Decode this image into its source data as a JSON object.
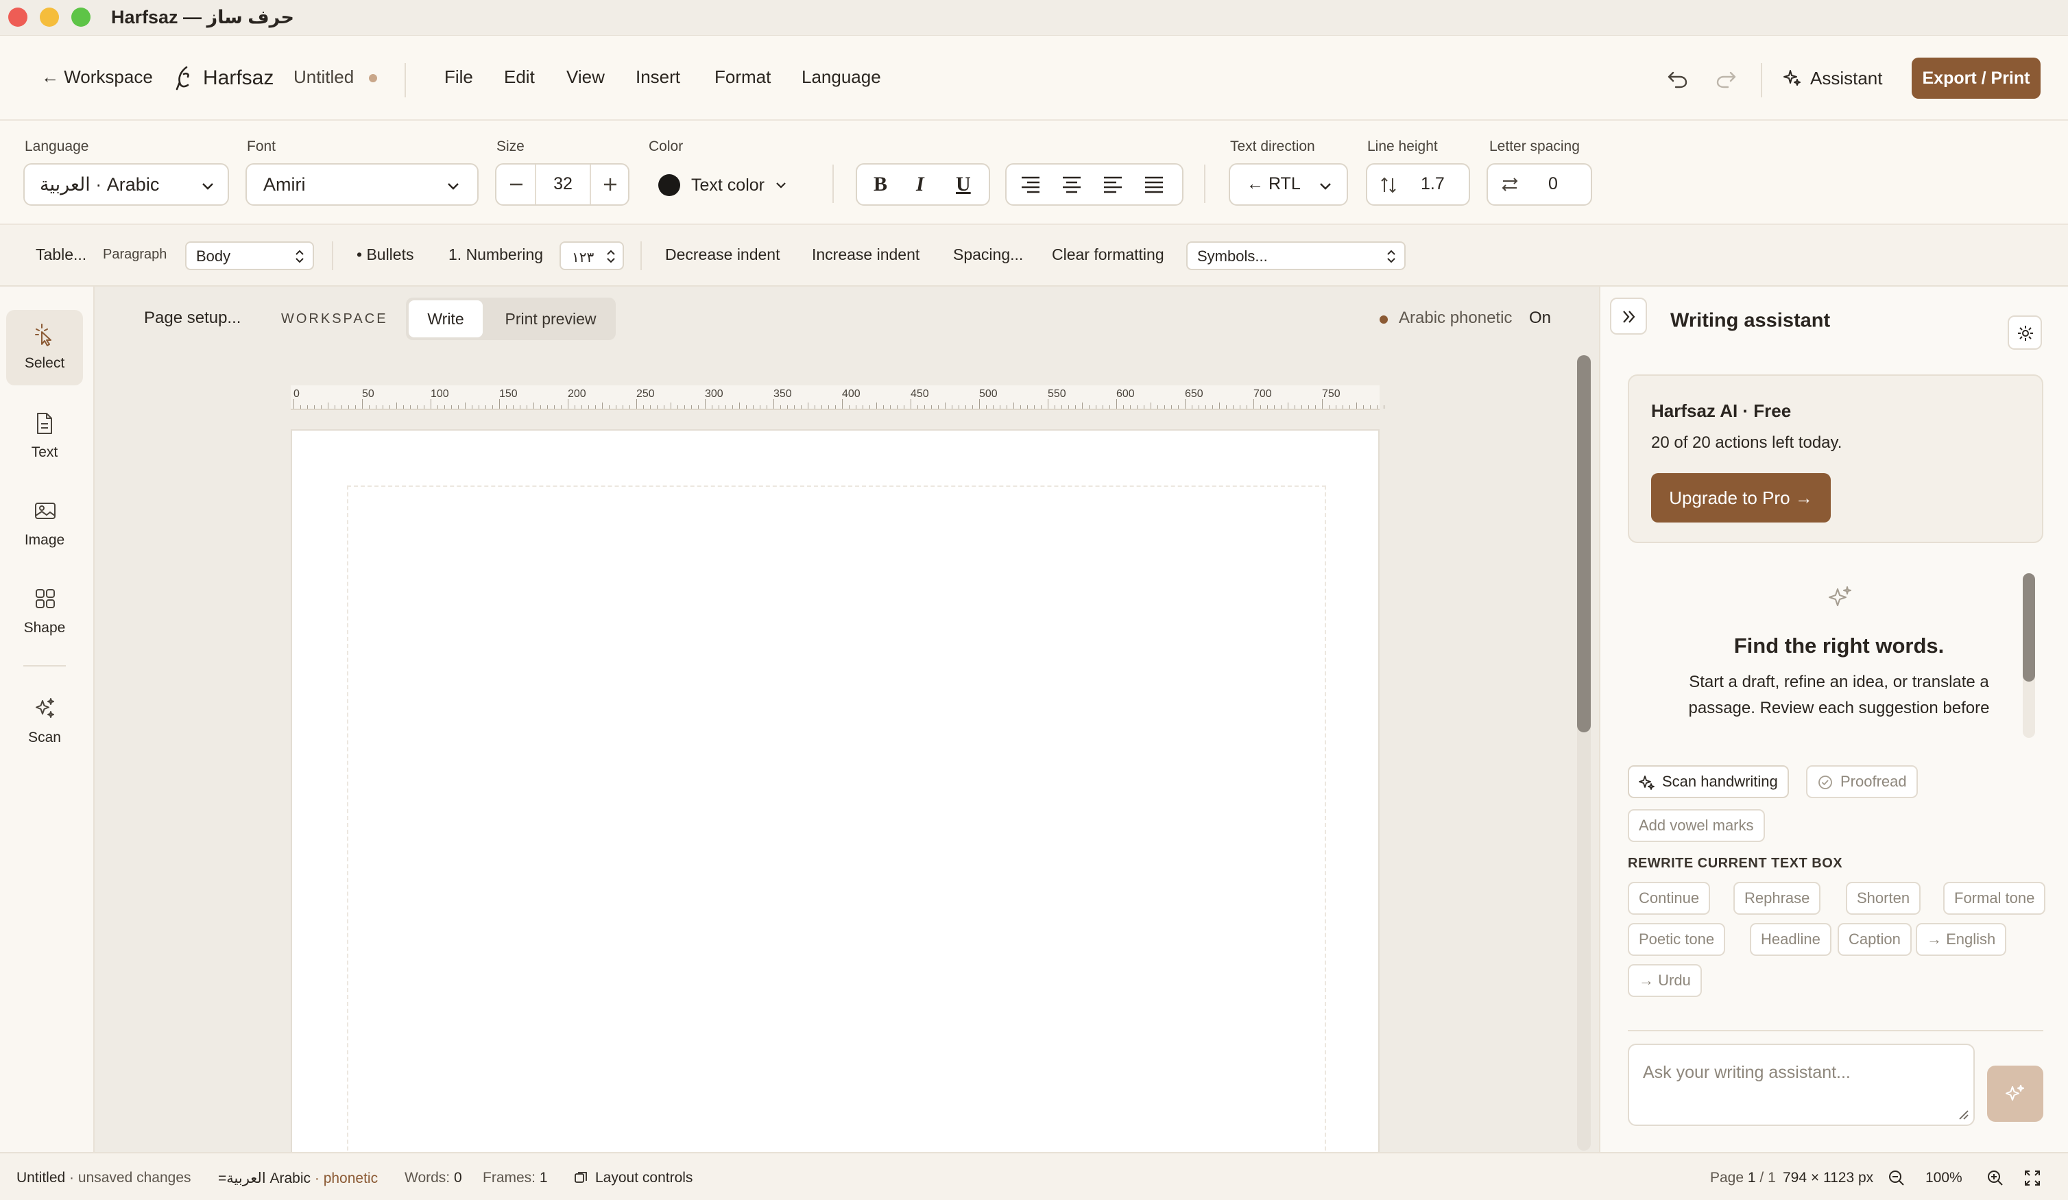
{
  "window": {
    "title": "Harfsaz — حرف ساز"
  },
  "menubar": {
    "back_label": "← Workspace",
    "brand": "Harfsaz",
    "doc_title": "Untitled",
    "menus": [
      "File",
      "Edit",
      "View",
      "Insert",
      "Format",
      "Language"
    ],
    "assistant_label": "Assistant",
    "export_label": "Export / Print"
  },
  "format_toolbar": {
    "language_label": "Language",
    "language_value": "العربية · Arabic",
    "font_label": "Font",
    "font_value": "Amiri",
    "size_label": "Size",
    "size_value": "32",
    "color_label": "Color",
    "color_value": "Text color",
    "bold": "B",
    "italic": "I",
    "underline": "U",
    "direction_label": "Text direction",
    "direction_value": "← RTL",
    "line_height_label": "Line height",
    "line_height_value": "1.7",
    "letter_spacing_label": "Letter spacing",
    "letter_spacing_value": "0"
  },
  "paragraph_bar": {
    "table": "Table...",
    "paragraph_label": "Paragraph",
    "paragraph_value": "Body",
    "bullets": "• Bullets",
    "numbering": "1. Numbering",
    "numbering_style": "١٢٣",
    "decrease_indent": "Decrease indent",
    "increase_indent": "Increase indent",
    "spacing": "Spacing...",
    "clear_formatting": "Clear formatting",
    "symbols": "Symbols..."
  },
  "tools": [
    {
      "label": "Select",
      "icon": "cursor-click-icon"
    },
    {
      "label": "Text",
      "icon": "document-icon"
    },
    {
      "label": "Image",
      "icon": "image-icon"
    },
    {
      "label": "Shape",
      "icon": "shape-grid-icon"
    },
    {
      "label": "Scan",
      "icon": "sparkles-icon"
    }
  ],
  "canvas_header": {
    "page_setup": "Page setup...",
    "workspace_label": "WORKSPACE",
    "modes": [
      "Write",
      "Print preview"
    ],
    "active_mode": "Write",
    "phonetic_label": "Arabic phonetic",
    "phonetic_state": "On"
  },
  "ruler": {
    "ticks": [
      "0",
      "50",
      "100",
      "150",
      "200",
      "250",
      "300",
      "350",
      "400",
      "450",
      "500",
      "550",
      "600",
      "650",
      "700",
      "750"
    ]
  },
  "assistant_panel": {
    "title": "Writing assistant",
    "plan_title": "Harfsaz AI · Free",
    "plan_quota": "20 of 20 actions left today.",
    "upgrade_label": "Upgrade to Pro →",
    "empty_title": "Find the right words.",
    "empty_body": "Start a draft, refine an idea, or translate a passage. Review each suggestion before adding it.",
    "quick_actions": [
      "Scan handwriting",
      "Proofread",
      "Add vowel marks"
    ],
    "rewrite_heading": "REWRITE CURRENT TEXT BOX",
    "rewrite_actions": [
      "Continue",
      "Rephrase",
      "Shorten",
      "Formal tone",
      "Poetic tone",
      "Headline",
      "Caption",
      "→ English",
      "→ Urdu"
    ],
    "input_placeholder": "Ask your writing assistant..."
  },
  "status_bar": {
    "doc_state_title": "Untitled",
    "doc_state_rest": " · unsaved changes",
    "lang_prefix": "=",
    "lang_script": "العربية",
    "lang_name": " Arabic",
    "lang_mode": " · phonetic",
    "words_label": "Words: ",
    "words_value": "0",
    "frames_label": "Frames: ",
    "frames_value": "1",
    "layout_controls": "Layout controls",
    "page_label": "Page ",
    "page_value": "1",
    "page_total": " / 1",
    "page_size": "794 × 1123 px",
    "zoom": "100%"
  },
  "colors": {
    "accent": "#8b5a34",
    "accent_light": "#c9a78a",
    "close": "#ee5d55",
    "minimize": "#f5bd3c",
    "maximize": "#5ec447"
  }
}
